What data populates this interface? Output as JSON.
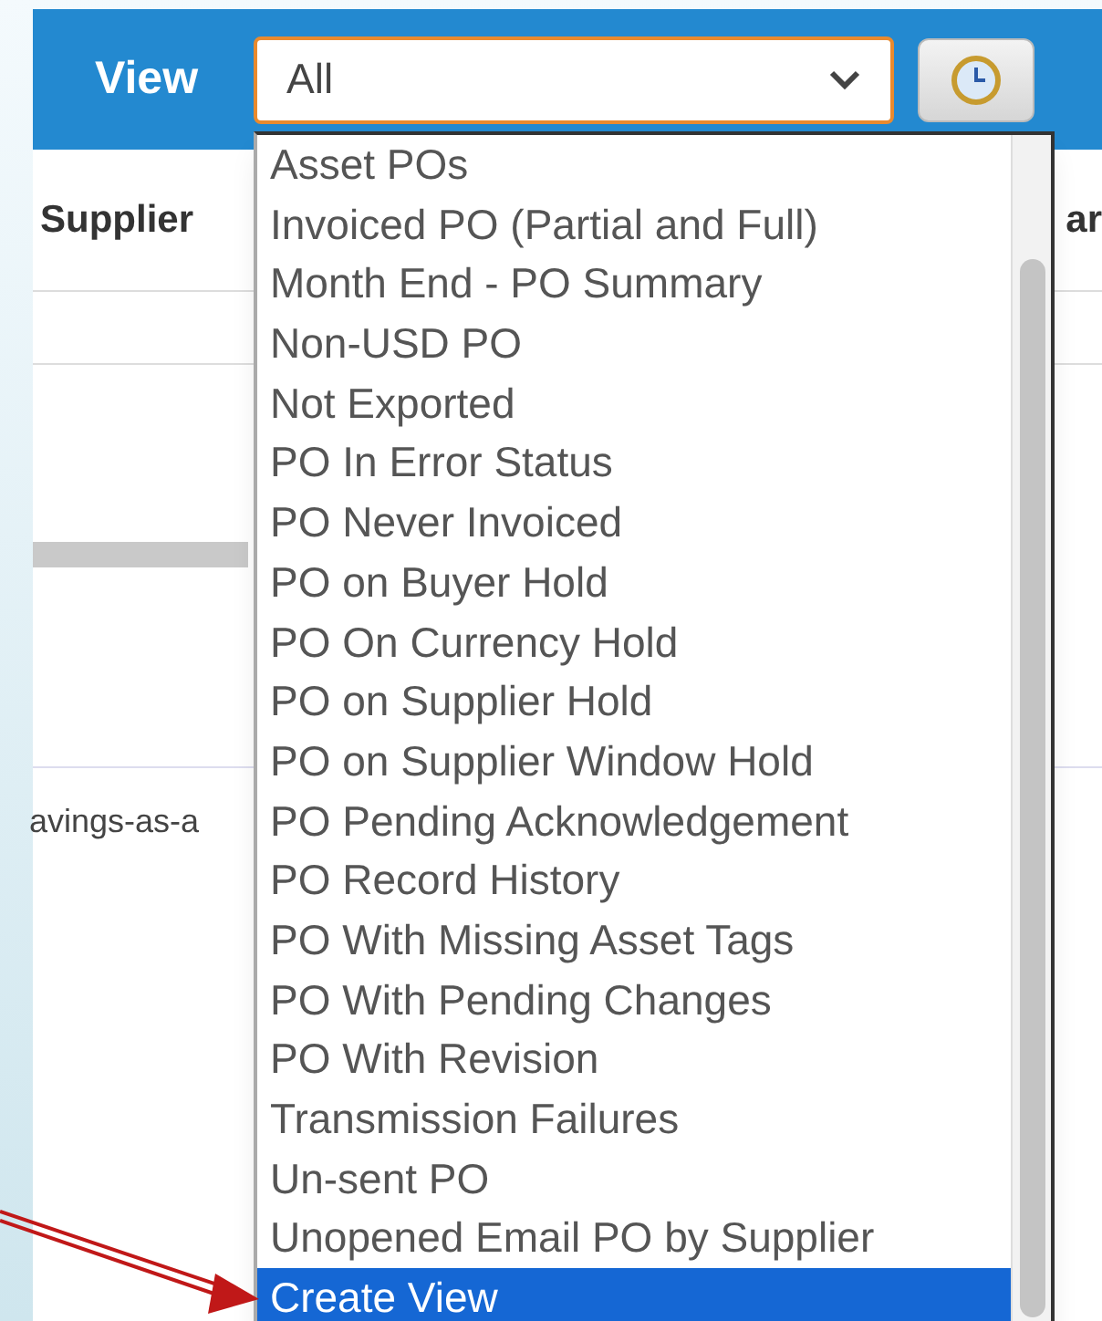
{
  "toolbar": {
    "label": "View",
    "select": {
      "value": "All"
    }
  },
  "table": {
    "columns": [
      "Supplier",
      "ar"
    ],
    "cells": [
      "avings-as-a"
    ]
  },
  "dropdown": {
    "options": [
      {
        "label": "Asset POs",
        "selected": false
      },
      {
        "label": "Invoiced PO (Partial and Full)",
        "selected": false
      },
      {
        "label": "Month End - PO Summary",
        "selected": false
      },
      {
        "label": "Non-USD PO",
        "selected": false
      },
      {
        "label": "Not Exported",
        "selected": false
      },
      {
        "label": "PO In Error Status",
        "selected": false
      },
      {
        "label": "PO Never Invoiced",
        "selected": false
      },
      {
        "label": "PO on Buyer Hold",
        "selected": false
      },
      {
        "label": "PO On Currency Hold",
        "selected": false
      },
      {
        "label": "PO on Supplier Hold",
        "selected": false
      },
      {
        "label": "PO on Supplier Window Hold",
        "selected": false
      },
      {
        "label": "PO Pending Acknowledgement",
        "selected": false
      },
      {
        "label": "PO Record History",
        "selected": false
      },
      {
        "label": "PO With Missing Asset Tags",
        "selected": false
      },
      {
        "label": "PO With Pending Changes",
        "selected": false
      },
      {
        "label": "PO With Revision",
        "selected": false
      },
      {
        "label": "Transmission Failures",
        "selected": false
      },
      {
        "label": "Un-sent PO",
        "selected": false
      },
      {
        "label": "Unopened Email PO by Supplier",
        "selected": false
      },
      {
        "label": "Create View",
        "selected": true
      }
    ]
  }
}
